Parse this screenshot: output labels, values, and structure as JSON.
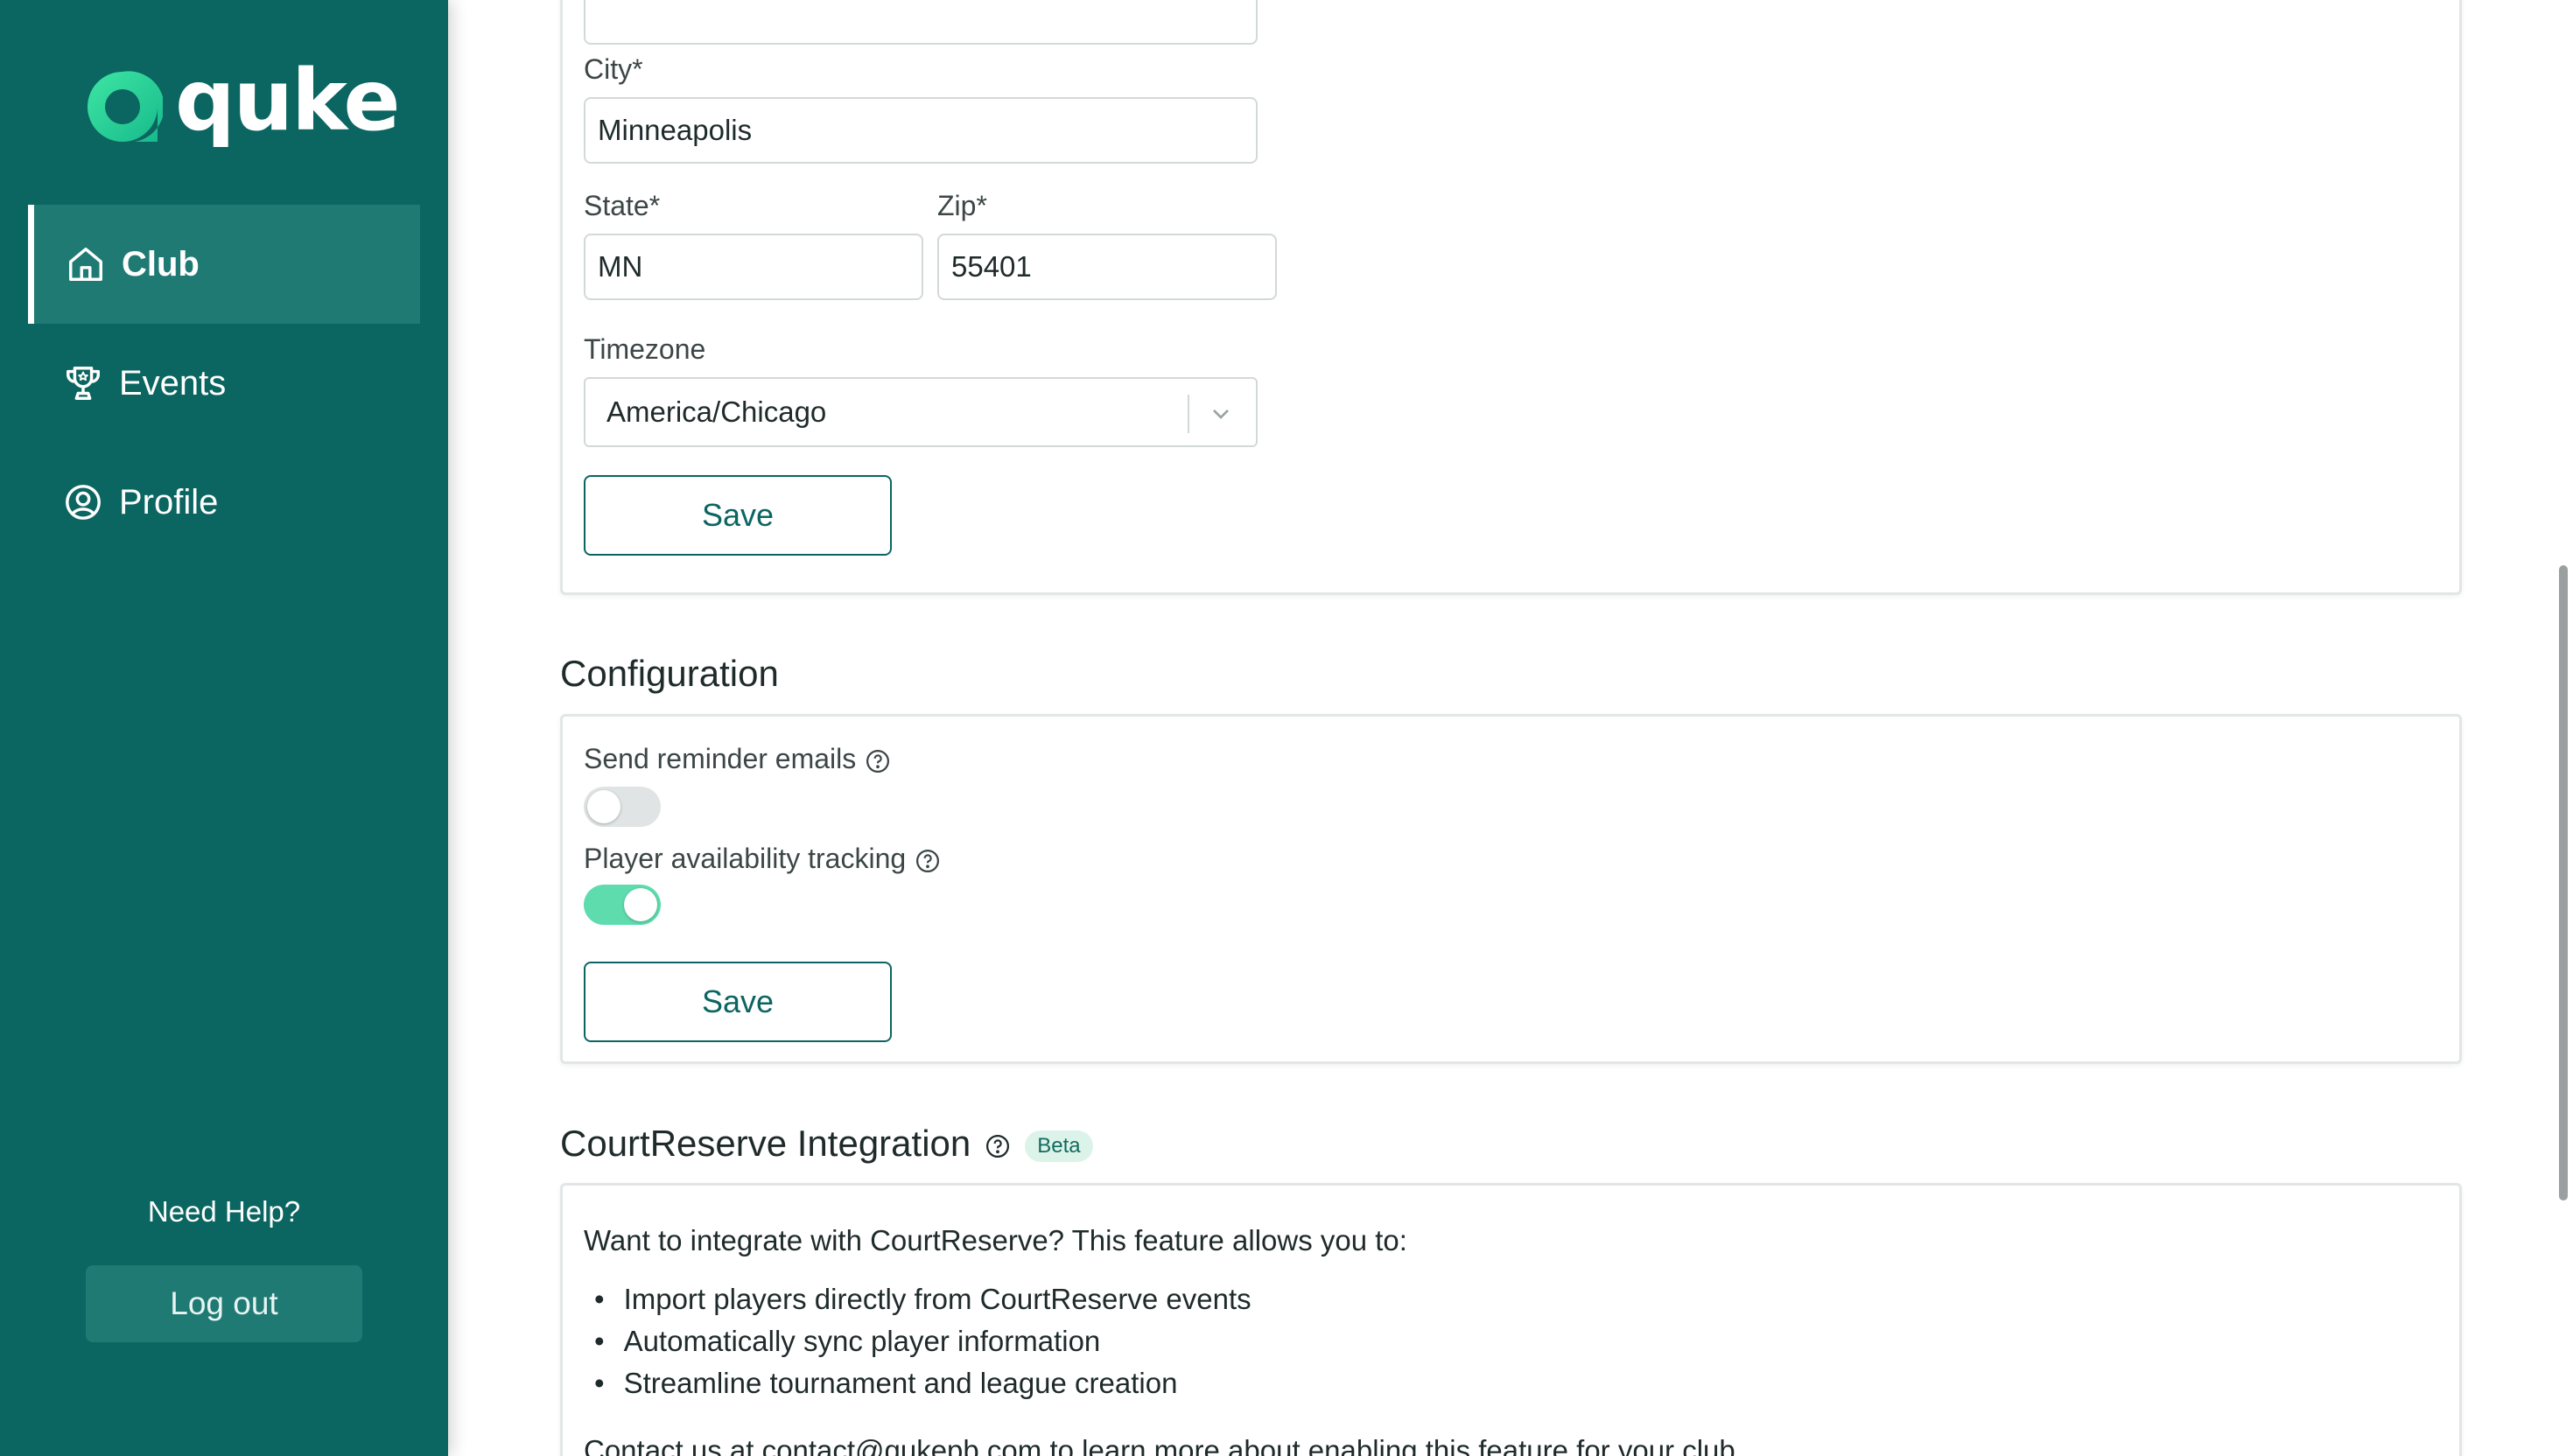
{
  "brand": {
    "name": "quke"
  },
  "sidebar": {
    "items": [
      {
        "label": "Club",
        "icon": "home-icon",
        "active": true
      },
      {
        "label": "Events",
        "icon": "trophy-icon",
        "active": false
      },
      {
        "label": "Profile",
        "icon": "user-circle-icon",
        "active": false
      }
    ],
    "help_label": "Need Help?",
    "logout_label": "Log out"
  },
  "address_form": {
    "city_label": "City*",
    "city_value": "Minneapolis",
    "state_label": "State*",
    "state_value": "MN",
    "zip_label": "Zip*",
    "zip_value": "55401",
    "timezone_label": "Timezone",
    "timezone_value": "America/Chicago",
    "save_label": "Save"
  },
  "configuration": {
    "title": "Configuration",
    "reminder_label": "Send reminder emails",
    "reminder_on": false,
    "availability_label": "Player availability tracking",
    "availability_on": true,
    "save_label": "Save"
  },
  "courtreserve": {
    "title": "CourtReserve Integration",
    "badge": "Beta",
    "intro": "Want to integrate with CourtReserve? This feature allows you to:",
    "bullets": [
      "Import players directly from CourtReserve events",
      "Automatically sync player information",
      "Streamline tournament and league creation"
    ],
    "contact": "Contact us at contact@qukepb.com to learn more about enabling this feature for your club."
  },
  "colors": {
    "sidebar_bg": "#0b6560",
    "accent": "#0b6560",
    "toggle_on": "#5edcae",
    "toggle_off": "#e1e4e4"
  }
}
